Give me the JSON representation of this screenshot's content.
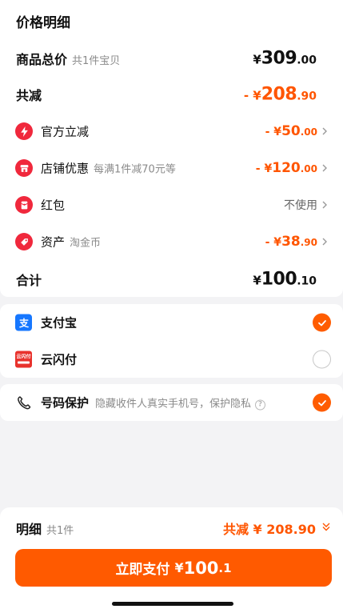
{
  "price_detail": {
    "title": "价格明细",
    "goods_total": {
      "label": "商品总价",
      "sub": "共1件宝贝",
      "yen": "¥",
      "int": "309",
      "dec": ".00"
    },
    "total_reduce": {
      "label": "共减",
      "prefix": "- ¥",
      "int": "208",
      "dec": ".90"
    },
    "items": [
      {
        "label": "官方立减",
        "sub": "",
        "prefix": "- ¥",
        "int": "50",
        "dec": ".00",
        "icon": "lightning-icon"
      },
      {
        "label": "店铺优惠",
        "sub": "每满1件减70元等",
        "prefix": "- ¥",
        "int": "120",
        "dec": ".00",
        "icon": "shop-icon"
      },
      {
        "label": "红包",
        "sub": "",
        "text": "不使用",
        "icon": "red-envelope-icon"
      },
      {
        "label": "资产",
        "sub": "淘金币",
        "prefix": "- ¥",
        "int": "38",
        "dec": ".90",
        "icon": "coin-tag-icon"
      }
    ],
    "sum": {
      "label": "合计",
      "yen": "¥",
      "int": "100",
      "dec": ".10"
    }
  },
  "payment": {
    "methods": [
      {
        "label": "支付宝",
        "selected": true,
        "icon": "alipay-icon"
      },
      {
        "label": "云闪付",
        "selected": false,
        "icon": "unionpay-cloud-icon",
        "icon_text": "云闪付"
      }
    ]
  },
  "privacy": {
    "label": "号码保护",
    "sub": "隐藏收件人真实手机号，保护隐私",
    "help": "?",
    "selected": true
  },
  "footer": {
    "title": "明细",
    "sub": "共1件",
    "total_text": "共减 ¥ 208.90",
    "button": {
      "label": "立即支付",
      "yen": "¥",
      "int": "100",
      "dec": ".1"
    }
  },
  "colors": {
    "accent": "#ff5a00",
    "red_icon": "#f0283c",
    "alipay_blue": "#1677ff"
  }
}
